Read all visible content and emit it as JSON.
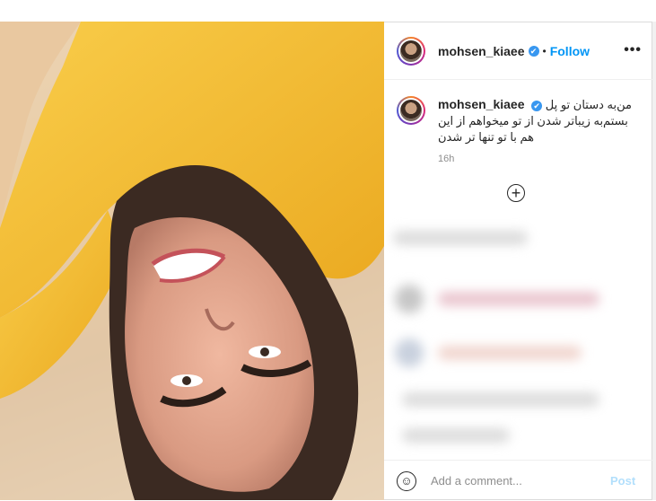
{
  "post": {
    "username": "mohsen_kiaee",
    "follow_label": "Follow",
    "dot": "•",
    "more_label": "•••",
    "verified_icon": "✔",
    "caption": {
      "line1": "من‌به دستان تو پل",
      "line2": "بستم‌به زیباتر شدن از تو میخواهم از این",
      "line3": "هم با تو تنها تر شدن"
    },
    "timestamp": "16h",
    "load_more_icon": "+",
    "comment": {
      "emoji_icon": "☺",
      "placeholder": "Add a comment...",
      "post_label": "Post"
    }
  },
  "colors": {
    "accent": "#0095f6",
    "verified": "#3897f0",
    "post_disabled": "#b2dffc",
    "shirt_yellow": "#f7c234"
  }
}
